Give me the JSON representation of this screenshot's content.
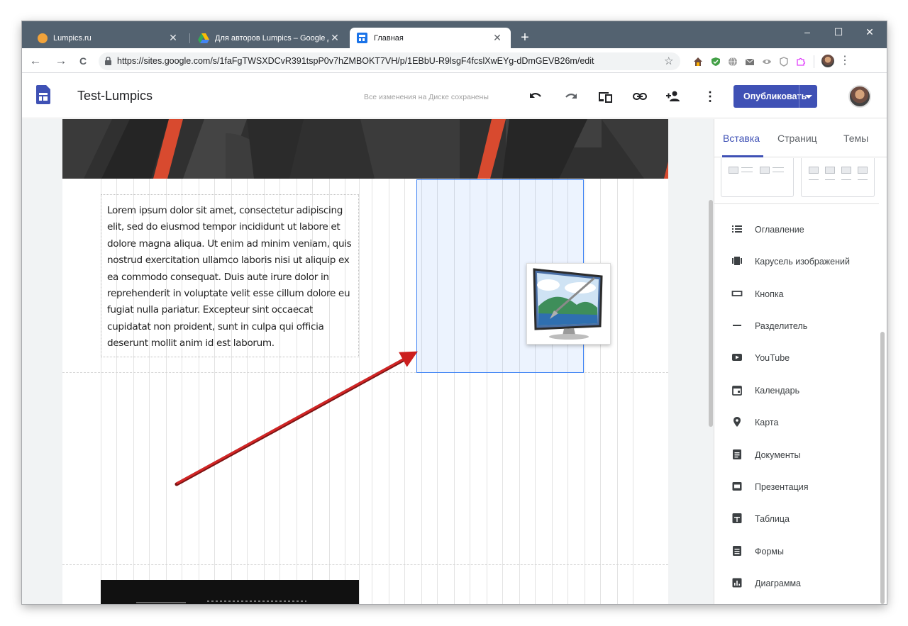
{
  "browser": {
    "tabs": [
      {
        "title": "Lumpics.ru",
        "icon": "orange-circle-favicon"
      },
      {
        "title": "Для авторов Lumpics – Google Д",
        "icon": "google-drive-favicon"
      },
      {
        "title": "Главная",
        "icon": "google-sites-favicon"
      }
    ],
    "new_tab": "+",
    "window_controls": {
      "minimize": "–",
      "maximize": "☐",
      "close": "✕"
    },
    "url": "https://sites.google.com/s/1faFgTWSXDCvR391tspP0v7hZMBOKT7VH/p/1EBbU-R9lsgF4fcslXwEYg-dDmGEVB26m/edit",
    "nav": {
      "back": "←",
      "forward": "→",
      "reload": "C"
    },
    "star": "☆",
    "menu": "⋮"
  },
  "sites": {
    "site_name": "Test-Lumpics",
    "save_status": "Все изменения на Диске сохранены",
    "publish_label": "Опубликовать",
    "more": "⋮"
  },
  "editor": {
    "lorem": "Lorem ipsum dolor sit amet, consectetur adipiscing elit, sed do eiusmod tempor incididunt ut labore et dolore magna aliqua. Ut enim ad minim veniam, quis nostrud exercitation ullamco laboris nisi ut aliquip ex ea commodo consequat. Duis aute irure dolor in reprehenderit in voluptate velit esse cillum dolore eu fugiat nulla pariatur. Excepteur sint occaecat cupidatat non proident, sunt in culpa qui officia deserunt mollit anim id est laborum."
  },
  "panel": {
    "tabs": [
      "Вставка",
      "Страниц",
      "Темы"
    ],
    "active_tab": "Вставка",
    "items": [
      {
        "label": "Оглавление",
        "icon": "toc-icon"
      },
      {
        "label": "Карусель изображений",
        "icon": "carousel-icon"
      },
      {
        "label": "Кнопка",
        "icon": "button-icon"
      },
      {
        "label": "Разделитель",
        "icon": "divider-icon"
      },
      {
        "label": "YouTube",
        "icon": "youtube-icon"
      },
      {
        "label": "Календарь",
        "icon": "calendar-icon"
      },
      {
        "label": "Карта",
        "icon": "map-pin-icon"
      },
      {
        "label": "Документы",
        "icon": "docs-icon"
      },
      {
        "label": "Презентация",
        "icon": "slides-icon"
      },
      {
        "label": "Таблица",
        "icon": "sheets-icon"
      },
      {
        "label": "Формы",
        "icon": "forms-icon"
      },
      {
        "label": "Диаграмма",
        "icon": "chart-icon"
      }
    ]
  },
  "colors": {
    "accent": "#3f51b5",
    "tabstrip": "#536270",
    "selection": "#4285f4",
    "arrow": "#cc1f1f"
  }
}
